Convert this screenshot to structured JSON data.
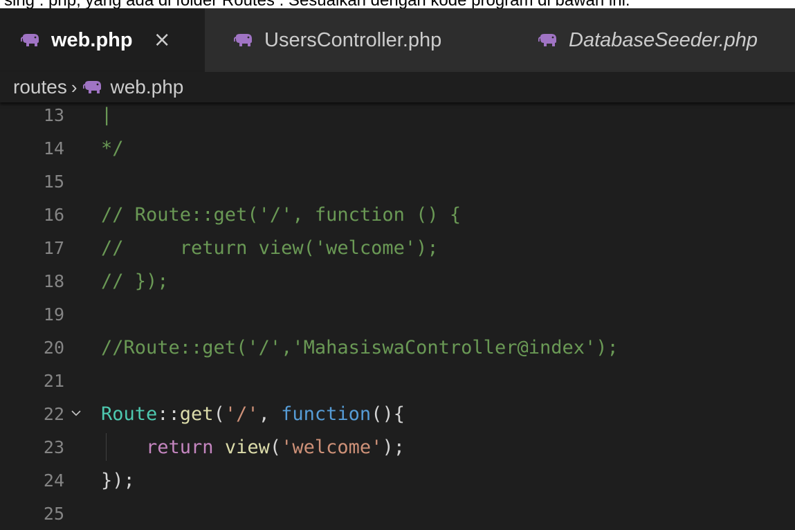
{
  "top_fragment": "sing . php, yang ada di folder Routes . Sesuaikan dengan kode program di bawah ini:",
  "tabs": [
    {
      "label": "web.php",
      "active": true,
      "close": "×"
    },
    {
      "label": "UsersController.php",
      "active": false
    },
    {
      "label": "DatabaseSeeder.php",
      "active": false,
      "italic": true
    }
  ],
  "breadcrumb": {
    "folder": "routes",
    "separator": "›",
    "file": "web.php"
  },
  "lines": [
    {
      "num": "13",
      "tokens": [
        {
          "t": "|",
          "c": "c-comment"
        }
      ]
    },
    {
      "num": "14",
      "tokens": [
        {
          "t": "*/",
          "c": "c-comment"
        }
      ]
    },
    {
      "num": "15",
      "tokens": []
    },
    {
      "num": "16",
      "tokens": [
        {
          "t": "// Route::get('/', function () {",
          "c": "c-comment"
        }
      ]
    },
    {
      "num": "17",
      "tokens": [
        {
          "t": "//     return view('welcome');",
          "c": "c-comment"
        }
      ]
    },
    {
      "num": "18",
      "tokens": [
        {
          "t": "// });",
          "c": "c-comment"
        }
      ]
    },
    {
      "num": "19",
      "tokens": []
    },
    {
      "num": "20",
      "tokens": [
        {
          "t": "//Route::get('/','MahasiswaController@index');",
          "c": "c-comment"
        }
      ]
    },
    {
      "num": "21",
      "tokens": []
    },
    {
      "num": "22",
      "fold": true,
      "tokens": [
        {
          "t": "Route",
          "c": "c-cls"
        },
        {
          "t": "::",
          "c": "c-punc"
        },
        {
          "t": "get",
          "c": "c-fn"
        },
        {
          "t": "(",
          "c": "c-punc"
        },
        {
          "t": "'/'",
          "c": "c-str"
        },
        {
          "t": ", ",
          "c": "c-punc"
        },
        {
          "t": "function",
          "c": "c-kw"
        },
        {
          "t": "(){",
          "c": "c-punc"
        }
      ]
    },
    {
      "num": "23",
      "tokens": [
        {
          "t": "    ",
          "c": "c-punc"
        },
        {
          "t": "return",
          "c": "c-ctl"
        },
        {
          "t": " ",
          "c": "c-punc"
        },
        {
          "t": "view",
          "c": "c-fn"
        },
        {
          "t": "(",
          "c": "c-punc"
        },
        {
          "t": "'welcome'",
          "c": "c-str"
        },
        {
          "t": ");",
          "c": "c-punc"
        }
      ]
    },
    {
      "num": "24",
      "tokens": [
        {
          "t": "});",
          "c": "c-punc"
        }
      ]
    },
    {
      "num": "25",
      "tokens": []
    }
  ],
  "colors": {
    "editor_bg": "#1e1e1e",
    "tabbar_bg": "#252526",
    "comment": "#6a9955",
    "class": "#4ec9b0",
    "function": "#dcdcaa",
    "string": "#ce9178",
    "keyword": "#569cd6",
    "control": "#c586c0",
    "php_icon": "#a074c4"
  },
  "icons": {
    "file": "php-elephant-icon",
    "close": "close-icon",
    "fold": "chevron-down-icon"
  }
}
